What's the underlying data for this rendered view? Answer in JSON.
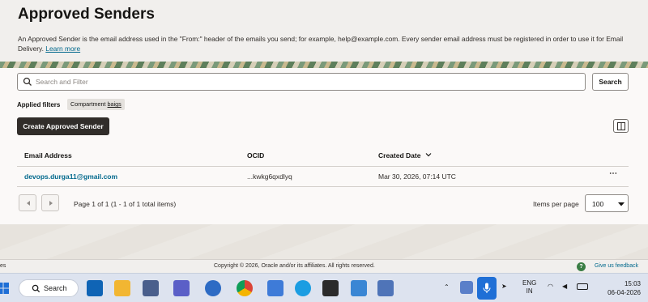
{
  "page": {
    "title": "Approved Senders",
    "description": "An Approved Sender is the email address used in the \"From:\" header of the emails you send; for example, help@example.com. Every sender email address must be registered in order to use it for Email Delivery.",
    "learn_more": "Learn more"
  },
  "search": {
    "placeholder": "Search and Filter",
    "button_label": "Search"
  },
  "filters": {
    "label": "Applied filters",
    "chip_key": "Compartment",
    "chip_value": "baigs"
  },
  "actions": {
    "create_label": "Create Approved Sender"
  },
  "table": {
    "columns": [
      "Email Address",
      "OCID",
      "Created Date"
    ],
    "rows": [
      {
        "email": "devops.durga11@gmail.com",
        "ocid": "...kwkg6qxdlyq",
        "created": "Mar 30, 2026, 07:14 UTC"
      }
    ],
    "more_icon": "more-horizontal-icon"
  },
  "pagination": {
    "info": "Page 1 of 1 (1 - 1 of 1 total items)",
    "items_per_page_label": "Items per page",
    "items_per_page_value": "100"
  },
  "footer": {
    "left_text": "es",
    "copyright": "Copyright © 2026, Oracle and/or its affiliates. All rights reserved.",
    "feedback": "Give us feedback"
  },
  "taskbar": {
    "search_label": "Search",
    "language_line1": "ENG",
    "language_line2": "IN",
    "time": "15:03",
    "date": "06-04-2026"
  },
  "colors": {
    "accent_link": "#00688c",
    "primary_button": "#312d2a",
    "taskbar": "#dde3ef"
  }
}
